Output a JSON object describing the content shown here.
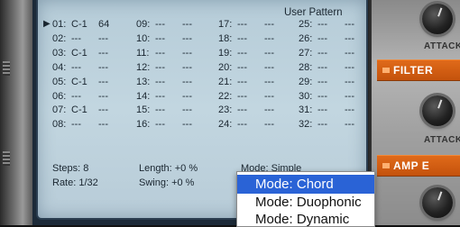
{
  "lcd": {
    "title": "User Pattern",
    "steps": [
      {
        "num": "01:",
        "note": "C-1",
        "vel": "64",
        "active": true
      },
      {
        "num": "02:",
        "note": "---",
        "vel": "---"
      },
      {
        "num": "03:",
        "note": "C-1",
        "vel": "---"
      },
      {
        "num": "04:",
        "note": "---",
        "vel": "---"
      },
      {
        "num": "05:",
        "note": "C-1",
        "vel": "---"
      },
      {
        "num": "06:",
        "note": "---",
        "vel": "---"
      },
      {
        "num": "07:",
        "note": "C-1",
        "vel": "---"
      },
      {
        "num": "08:",
        "note": "---",
        "vel": "---"
      },
      {
        "num": "09:",
        "note": "---",
        "vel": "---"
      },
      {
        "num": "10:",
        "note": "---",
        "vel": "---"
      },
      {
        "num": "11:",
        "note": "---",
        "vel": "---"
      },
      {
        "num": "12:",
        "note": "---",
        "vel": "---"
      },
      {
        "num": "13:",
        "note": "---",
        "vel": "---"
      },
      {
        "num": "14:",
        "note": "---",
        "vel": "---"
      },
      {
        "num": "15:",
        "note": "---",
        "vel": "---"
      },
      {
        "num": "16:",
        "note": "---",
        "vel": "---"
      },
      {
        "num": "17:",
        "note": "---",
        "vel": "---"
      },
      {
        "num": "18:",
        "note": "---",
        "vel": "---"
      },
      {
        "num": "19:",
        "note": "---",
        "vel": "---"
      },
      {
        "num": "20:",
        "note": "---",
        "vel": "---"
      },
      {
        "num": "21:",
        "note": "---",
        "vel": "---"
      },
      {
        "num": "22:",
        "note": "---",
        "vel": "---"
      },
      {
        "num": "23:",
        "note": "---",
        "vel": "---"
      },
      {
        "num": "24:",
        "note": "---",
        "vel": "---"
      },
      {
        "num": "25:",
        "note": "---",
        "vel": "---"
      },
      {
        "num": "26:",
        "note": "---",
        "vel": "---"
      },
      {
        "num": "27:",
        "note": "---",
        "vel": "---"
      },
      {
        "num": "28:",
        "note": "---",
        "vel": "---"
      },
      {
        "num": "29:",
        "note": "---",
        "vel": "---"
      },
      {
        "num": "30:",
        "note": "---",
        "vel": "---"
      },
      {
        "num": "31:",
        "note": "---",
        "vel": "---"
      },
      {
        "num": "32:",
        "note": "---",
        "vel": "---"
      }
    ],
    "play_marker": "▶",
    "steps_label": "Steps: 8",
    "rate_label": "Rate: 1/32",
    "length_label": "Length: +0 %",
    "swing_label": "Swing: +0 %",
    "mode_label": "Mode: Simple"
  },
  "mode_menu": {
    "options": [
      "Mode: Chord",
      "Mode: Duophonic",
      "Mode: Dynamic"
    ],
    "selected_index": 0
  },
  "right_panel": {
    "attack_label_1": "ATTACK",
    "filter_label": "FILTER",
    "attack_label_2": "ATTACK",
    "amp_label": "AMP E"
  }
}
